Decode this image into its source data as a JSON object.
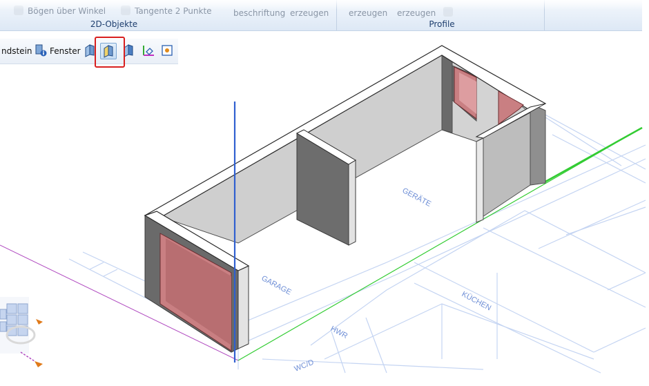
{
  "ribbon": {
    "items": [
      {
        "label": "Bögen über Winkel"
      },
      {
        "label": "Tangente 2 Punkte"
      },
      {
        "label": "beschriftung"
      },
      {
        "label": "erzeugen"
      },
      {
        "label": "erzeugen"
      },
      {
        "label": "erzeugen"
      }
    ],
    "groups": [
      {
        "label": "2D-Objekte"
      },
      {
        "label": "Profile"
      }
    ]
  },
  "toolbar": {
    "eckstein_label": "ndstein",
    "fenster_label": "Fenster",
    "buttons": [
      {
        "icon": "wall-panel-icon"
      },
      {
        "icon": "wall-panel-selected-icon",
        "active": true
      },
      {
        "icon": "wall-panel-alt-icon"
      },
      {
        "icon": "plane-axis-icon"
      },
      {
        "icon": "point-snap-icon"
      }
    ]
  },
  "plan_labels": {
    "garage": "GARAGE",
    "geraete": "GERÄTE",
    "kuechen": "KÜCHEN",
    "hwr": "HWR",
    "wc": "WC/D"
  },
  "colors": {
    "wall_top": "#ffffff",
    "wall_light": "#cfcfcf",
    "wall_dark": "#6a6a6a",
    "opening": "#c97f82",
    "axis_z": "#2f5fd0",
    "axis_y": "#33cc33",
    "axis_x": "#b04ac0",
    "plan_lines": "#c4d4f2",
    "highlight": "#d81e1e"
  }
}
